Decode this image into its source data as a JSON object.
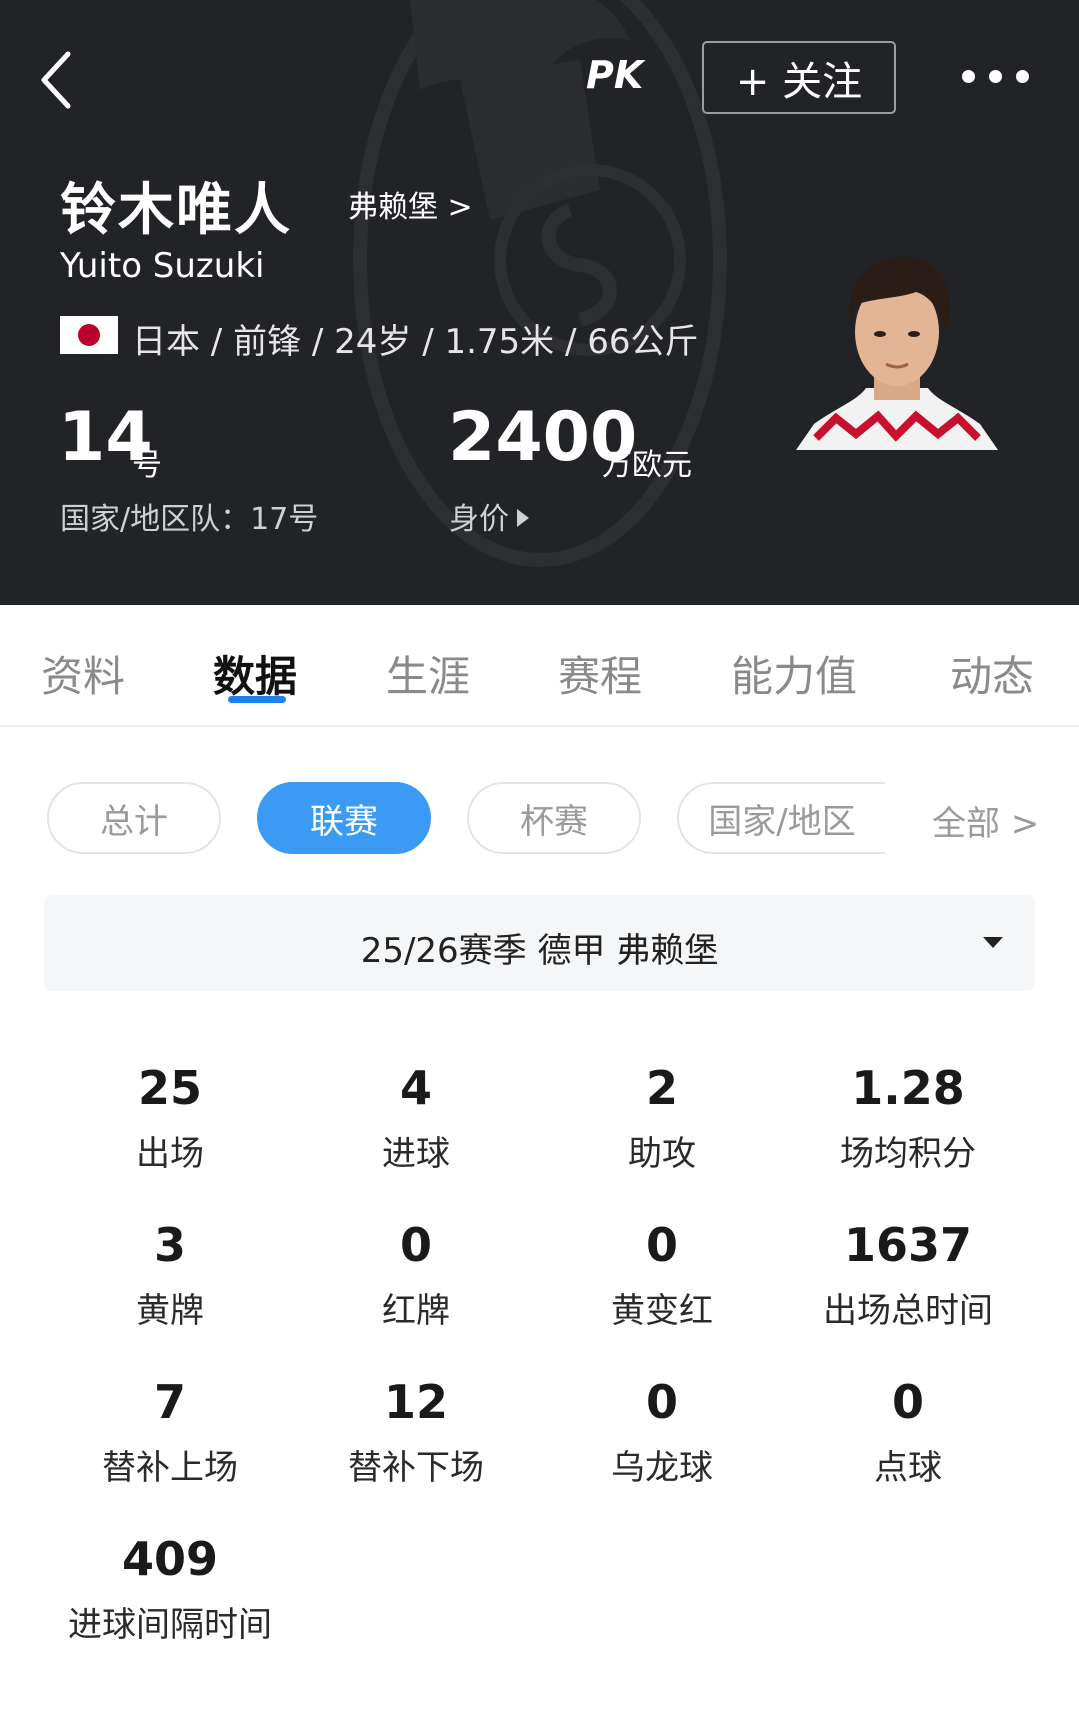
{
  "header": {
    "logo_text": "PK",
    "follow_label": "+ 关注",
    "name_cn": "铃木唯人",
    "name_en": "Yuito Suzuki",
    "club_link": "弗赖堡 >",
    "bio": "日本 / 前锋 / 24岁 / 1.75米 / 66公斤",
    "shirt_number": "14",
    "shirt_unit": "号",
    "national_team": "国家/地区队：17号",
    "market_value": "2400",
    "market_value_unit": "万欧元",
    "market_value_label": "身价",
    "icons": {
      "back": "chevron-left-icon",
      "more": "more-horizontal-icon",
      "flag": "japan-flag-icon"
    }
  },
  "tabs": [
    {
      "label": "资料",
      "active": false
    },
    {
      "label": "数据",
      "active": true
    },
    {
      "label": "生涯",
      "active": false
    },
    {
      "label": "赛程",
      "active": false
    },
    {
      "label": "能力值",
      "active": false
    },
    {
      "label": "动态",
      "active": false
    }
  ],
  "filters": [
    {
      "label": "总计",
      "active": false
    },
    {
      "label": "联赛",
      "active": true
    },
    {
      "label": "杯赛",
      "active": false
    },
    {
      "label": "国家/地区",
      "active": false
    }
  ],
  "all_link": "全部 >",
  "season_selector": "25/26赛季 德甲 弗赖堡",
  "stats": [
    {
      "value": "25",
      "label": "出场"
    },
    {
      "value": "4",
      "label": "进球"
    },
    {
      "value": "2",
      "label": "助攻"
    },
    {
      "value": "1.28",
      "label": "场均积分"
    },
    {
      "value": "3",
      "label": "黄牌"
    },
    {
      "value": "0",
      "label": "红牌"
    },
    {
      "value": "0",
      "label": "黄变红"
    },
    {
      "value": "1637",
      "label": "出场总时间"
    },
    {
      "value": "7",
      "label": "替补上场"
    },
    {
      "value": "12",
      "label": "替补下场"
    },
    {
      "value": "0",
      "label": "乌龙球"
    },
    {
      "value": "0",
      "label": "点球"
    },
    {
      "value": "409",
      "label": "进球间隔时间"
    }
  ],
  "colors": {
    "header_bg": "#222326",
    "accent_blue": "#3a9af4",
    "tab_underline": "#1d7ff2",
    "flag_red": "#bc002d"
  }
}
